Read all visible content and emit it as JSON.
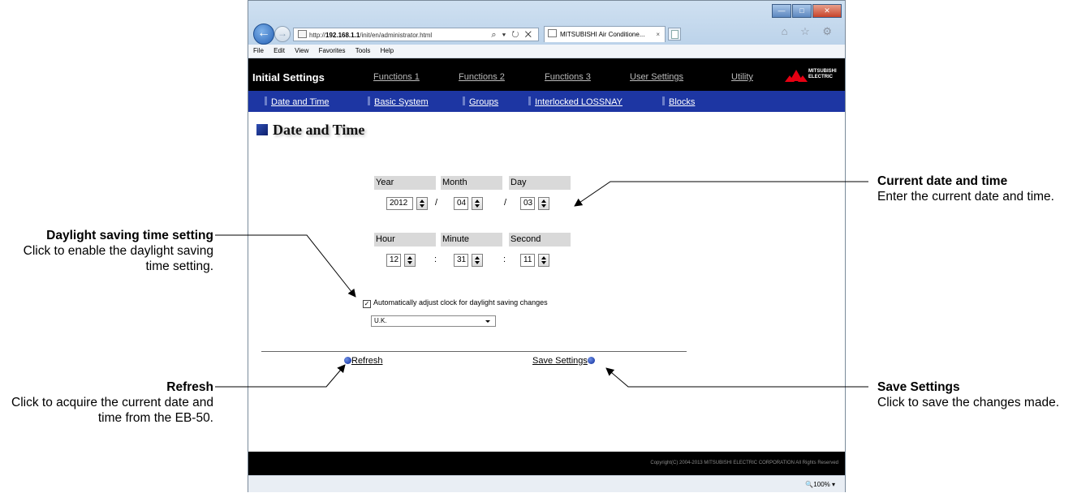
{
  "browser": {
    "address_prefix": "http://",
    "address_host": "192.168.1.1",
    "address_path": "/init/en/administrator.html",
    "address_tools": "⌕ ▾ ↻ ✕",
    "tab_title": "MITSUBISHI Air Conditione...",
    "tab_close": "×",
    "toolbar_icons": "⌂ ☆ ⚙",
    "menu": [
      "File",
      "Edit",
      "View",
      "Favorites",
      "Tools",
      "Help"
    ],
    "zoom": "🔍100%  ▾"
  },
  "app": {
    "title": "Initial Settings",
    "tabs": [
      "Functions 1",
      "Functions 2",
      "Functions 3",
      "User Settings",
      "Utility"
    ],
    "logo_line1": "MITSUBISHI",
    "logo_line2": "ELECTRIC",
    "subnav": [
      "Date and Time",
      "Basic System",
      "Groups",
      "Interlocked LOSSNAY",
      "Blocks"
    ],
    "page_heading": "Date and Time",
    "date": {
      "year_label": "Year",
      "month_label": "Month",
      "day_label": "Day",
      "year": "2012",
      "month": "04",
      "day": "03",
      "separator": "/"
    },
    "time": {
      "hour_label": "Hour",
      "minute_label": "Minute",
      "second_label": "Second",
      "hour": "12",
      "minute": "31",
      "second": "11",
      "separator": ":"
    },
    "dst": {
      "checkbox_mark": "✓",
      "label": "Automatically adjust clock for daylight saving changes",
      "region": "U.K."
    },
    "refresh_label": "Refresh",
    "save_label": "Save Settings",
    "copyright": "Copyright(C) 2004-2013 MITSUBISHI ELECTRIC CORPORATION All Rights Reserved"
  },
  "callouts": {
    "current_title": "Current date and time",
    "current_desc": "Enter the current date and time.",
    "dst_title": "Daylight saving time setting",
    "dst_desc": "Click to enable the daylight saving time setting.",
    "refresh_title": "Refresh",
    "refresh_desc": "Click to acquire the current date and time from the EB-50.",
    "save_title": "Save Settings",
    "save_desc": "Click to save the changes made."
  }
}
